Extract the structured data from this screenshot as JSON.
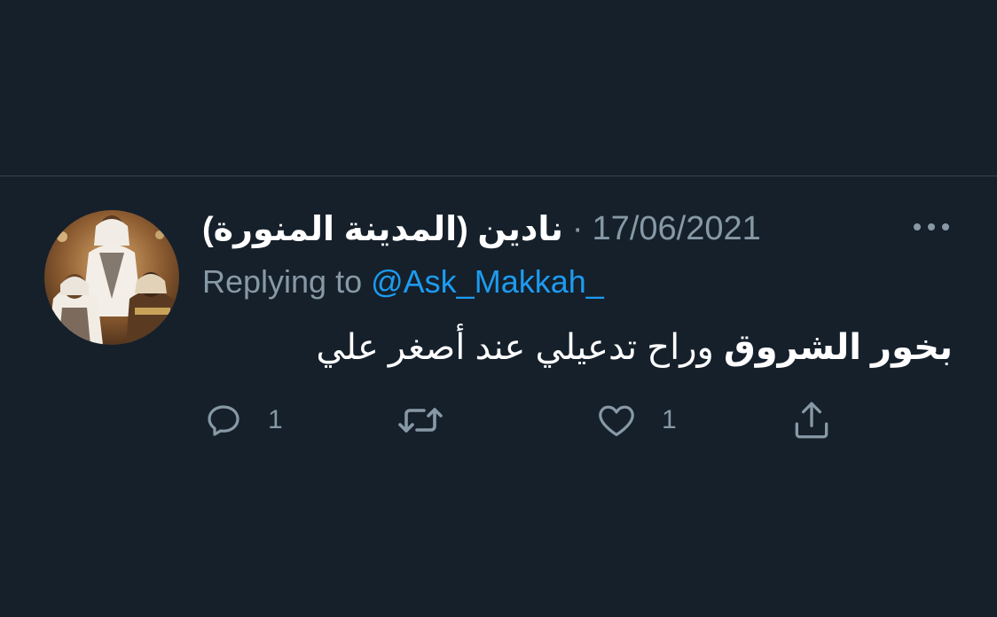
{
  "tweet": {
    "display_name": "نادين (المدينة المنورة)",
    "separator": "·",
    "date": "17/06/2021",
    "more_icon": "more-horizontal-icon",
    "replying_prefix": "Replying to",
    "replying_handle": "@Ask_Makkah_",
    "text_bold": "بخور الشروق",
    "text_rest": "وراح تدعيلي عند أصغر علي",
    "actions": {
      "reply": {
        "icon": "reply-icon",
        "count": "1"
      },
      "retweet": {
        "icon": "retweet-icon",
        "count": ""
      },
      "like": {
        "icon": "heart-icon",
        "count": "1"
      },
      "share": {
        "icon": "share-icon"
      }
    }
  },
  "colors": {
    "background": "#15202b",
    "divider": "#38444d",
    "secondary_text": "#8899a6",
    "primary_text": "#ffffff",
    "accent": "#1d9bf0"
  }
}
